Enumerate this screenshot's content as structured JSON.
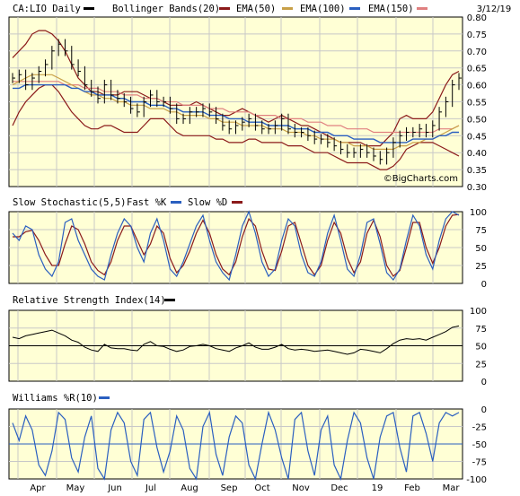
{
  "chart_data": [
    {
      "panel": "price",
      "type": "ohlc",
      "title": "CA:LIO Daily",
      "date": "3/12/19",
      "legend": [
        {
          "name": "CA:LIO Daily",
          "color": "#000000"
        },
        {
          "name": "Bollinger Bands(20)",
          "color": "#8b1a1a"
        },
        {
          "name": "EMA(50)",
          "color": "#c8a048"
        },
        {
          "name": "EMA(100)",
          "color": "#2a5fc0"
        },
        {
          "name": "EMA(150)",
          "color": "#e08080"
        }
      ],
      "watermark": "©BigCharts.com",
      "ylim": [
        0.3,
        0.8
      ],
      "y_ticks": [
        "0.30",
        "0.35",
        "0.40",
        "0.45",
        "0.50",
        "0.55",
        "0.60",
        "0.65",
        "0.70",
        "0.75",
        "0.80"
      ],
      "x_labels": [
        "Apr",
        "May",
        "Jun",
        "Jul",
        "Aug",
        "Sep",
        "Oct",
        "Nov",
        "Dec",
        "19",
        "Feb",
        "Mar"
      ],
      "close": [
        0.62,
        0.63,
        0.6,
        0.62,
        0.64,
        0.66,
        0.7,
        0.72,
        0.7,
        0.66,
        0.64,
        0.6,
        0.58,
        0.56,
        0.6,
        0.57,
        0.56,
        0.55,
        0.53,
        0.52,
        0.55,
        0.57,
        0.55,
        0.55,
        0.53,
        0.5,
        0.5,
        0.52,
        0.52,
        0.53,
        0.52,
        0.5,
        0.48,
        0.47,
        0.48,
        0.49,
        0.5,
        0.48,
        0.47,
        0.47,
        0.48,
        0.5,
        0.47,
        0.46,
        0.46,
        0.45,
        0.44,
        0.44,
        0.43,
        0.42,
        0.41,
        0.4,
        0.4,
        0.41,
        0.4,
        0.39,
        0.38,
        0.4,
        0.43,
        0.45,
        0.46,
        0.46,
        0.47,
        0.46,
        0.48,
        0.52,
        0.55,
        0.6,
        0.62
      ],
      "bb_upper": [
        0.68,
        0.7,
        0.72,
        0.75,
        0.76,
        0.76,
        0.75,
        0.73,
        0.7,
        0.66,
        0.62,
        0.6,
        0.58,
        0.58,
        0.57,
        0.57,
        0.57,
        0.58,
        0.58,
        0.58,
        0.57,
        0.56,
        0.56,
        0.55,
        0.54,
        0.54,
        0.54,
        0.54,
        0.55,
        0.54,
        0.53,
        0.52,
        0.51,
        0.51,
        0.52,
        0.53,
        0.52,
        0.51,
        0.5,
        0.49,
        0.5,
        0.51,
        0.5,
        0.49,
        0.48,
        0.48,
        0.47,
        0.46,
        0.45,
        0.44,
        0.43,
        0.43,
        0.43,
        0.43,
        0.42,
        0.42,
        0.42,
        0.44,
        0.46,
        0.5,
        0.51,
        0.5,
        0.5,
        0.5,
        0.52,
        0.56,
        0.6,
        0.63,
        0.64
      ],
      "bb_lower": [
        0.48,
        0.52,
        0.55,
        0.57,
        0.59,
        0.6,
        0.6,
        0.58,
        0.55,
        0.52,
        0.5,
        0.48,
        0.47,
        0.47,
        0.48,
        0.48,
        0.47,
        0.46,
        0.46,
        0.46,
        0.48,
        0.5,
        0.5,
        0.5,
        0.48,
        0.46,
        0.45,
        0.45,
        0.45,
        0.45,
        0.45,
        0.44,
        0.44,
        0.43,
        0.43,
        0.43,
        0.44,
        0.44,
        0.43,
        0.43,
        0.43,
        0.43,
        0.42,
        0.42,
        0.42,
        0.41,
        0.4,
        0.4,
        0.4,
        0.39,
        0.38,
        0.37,
        0.37,
        0.37,
        0.37,
        0.36,
        0.35,
        0.35,
        0.36,
        0.38,
        0.41,
        0.42,
        0.43,
        0.43,
        0.43,
        0.42,
        0.41,
        0.4,
        0.39
      ],
      "ema50": [
        0.6,
        0.61,
        0.62,
        0.63,
        0.63,
        0.63,
        0.63,
        0.62,
        0.61,
        0.6,
        0.59,
        0.58,
        0.57,
        0.57,
        0.56,
        0.56,
        0.55,
        0.55,
        0.54,
        0.54,
        0.54,
        0.53,
        0.53,
        0.53,
        0.52,
        0.52,
        0.51,
        0.51,
        0.51,
        0.51,
        0.5,
        0.5,
        0.49,
        0.49,
        0.49,
        0.48,
        0.48,
        0.48,
        0.48,
        0.47,
        0.47,
        0.47,
        0.46,
        0.46,
        0.46,
        0.45,
        0.45,
        0.44,
        0.44,
        0.44,
        0.43,
        0.43,
        0.42,
        0.42,
        0.42,
        0.41,
        0.41,
        0.41,
        0.41,
        0.42,
        0.42,
        0.43,
        0.43,
        0.44,
        0.44,
        0.45,
        0.46,
        0.47,
        0.48
      ],
      "ema100": [
        0.59,
        0.59,
        0.6,
        0.6,
        0.6,
        0.6,
        0.6,
        0.6,
        0.6,
        0.59,
        0.59,
        0.58,
        0.58,
        0.57,
        0.57,
        0.57,
        0.56,
        0.56,
        0.55,
        0.55,
        0.55,
        0.54,
        0.54,
        0.54,
        0.53,
        0.53,
        0.52,
        0.52,
        0.52,
        0.52,
        0.51,
        0.51,
        0.51,
        0.5,
        0.5,
        0.5,
        0.49,
        0.49,
        0.49,
        0.48,
        0.48,
        0.48,
        0.48,
        0.47,
        0.47,
        0.47,
        0.46,
        0.46,
        0.46,
        0.45,
        0.45,
        0.45,
        0.44,
        0.44,
        0.44,
        0.44,
        0.43,
        0.43,
        0.43,
        0.43,
        0.43,
        0.44,
        0.44,
        0.44,
        0.44,
        0.45,
        0.45,
        0.46,
        0.46
      ],
      "ema150": [
        0.61,
        0.61,
        0.61,
        0.61,
        0.61,
        0.61,
        0.61,
        0.61,
        0.6,
        0.6,
        0.6,
        0.59,
        0.59,
        0.59,
        0.58,
        0.58,
        0.58,
        0.57,
        0.57,
        0.57,
        0.56,
        0.56,
        0.56,
        0.55,
        0.55,
        0.55,
        0.54,
        0.54,
        0.54,
        0.54,
        0.53,
        0.53,
        0.53,
        0.52,
        0.52,
        0.52,
        0.52,
        0.51,
        0.51,
        0.51,
        0.51,
        0.5,
        0.5,
        0.5,
        0.5,
        0.49,
        0.49,
        0.49,
        0.48,
        0.48,
        0.48,
        0.47,
        0.47,
        0.47,
        0.47,
        0.46,
        0.46,
        0.46,
        0.46,
        0.46,
        0.46,
        0.46,
        0.46,
        0.46,
        0.46,
        0.47,
        0.47,
        0.47,
        0.48
      ]
    },
    {
      "panel": "stochastic",
      "type": "line",
      "title": "Slow Stochastic(5,5)",
      "legend": [
        {
          "name": "Fast %K",
          "color": "#2a5fc0"
        },
        {
          "name": "Slow %D",
          "color": "#8b1a1a"
        }
      ],
      "ylim": [
        0,
        100
      ],
      "y_ticks": [
        "0",
        "25",
        "50",
        "75",
        "100"
      ],
      "fast_k": [
        70,
        60,
        80,
        75,
        40,
        20,
        10,
        30,
        85,
        90,
        60,
        40,
        20,
        10,
        5,
        40,
        70,
        90,
        80,
        50,
        30,
        70,
        90,
        60,
        20,
        10,
        30,
        55,
        80,
        95,
        60,
        30,
        15,
        5,
        40,
        80,
        100,
        70,
        30,
        10,
        20,
        60,
        90,
        80,
        40,
        15,
        10,
        30,
        70,
        95,
        60,
        20,
        10,
        40,
        85,
        90,
        55,
        15,
        5,
        20,
        60,
        95,
        80,
        40,
        20,
        60,
        90,
        100,
        95
      ],
      "slow_d": [
        65,
        65,
        72,
        74,
        60,
        40,
        25,
        25,
        55,
        80,
        75,
        55,
        30,
        18,
        12,
        30,
        60,
        80,
        80,
        60,
        40,
        55,
        80,
        70,
        35,
        15,
        25,
        45,
        70,
        88,
        70,
        40,
        20,
        12,
        30,
        65,
        90,
        80,
        45,
        20,
        18,
        45,
        80,
        85,
        55,
        25,
        12,
        25,
        60,
        85,
        70,
        35,
        15,
        30,
        70,
        88,
        65,
        25,
        10,
        18,
        50,
        85,
        85,
        50,
        28,
        50,
        80,
        95,
        96
      ]
    },
    {
      "panel": "rsi",
      "type": "line",
      "title": "Relative Strength Index(14)",
      "ylim": [
        0,
        100
      ],
      "y_ticks": [
        "0",
        "25",
        "50",
        "75",
        "100"
      ],
      "reference_line": 50,
      "values": [
        62,
        60,
        64,
        66,
        68,
        70,
        72,
        68,
        64,
        58,
        55,
        48,
        44,
        42,
        52,
        47,
        46,
        46,
        44,
        43,
        52,
        56,
        50,
        49,
        45,
        42,
        44,
        49,
        50,
        52,
        50,
        46,
        44,
        42,
        47,
        50,
        54,
        48,
        45,
        45,
        48,
        52,
        46,
        44,
        45,
        44,
        42,
        43,
        44,
        42,
        40,
        38,
        40,
        45,
        44,
        42,
        40,
        46,
        53,
        58,
        60,
        59,
        60,
        58,
        62,
        66,
        70,
        76,
        78
      ]
    },
    {
      "panel": "williams",
      "type": "line",
      "title": "Williams %R(10)",
      "legend": [
        {
          "name": "Williams %R(10)",
          "color": "#2a5fc0"
        }
      ],
      "ylim": [
        -100,
        0
      ],
      "y_ticks": [
        "-100",
        "-75",
        "-50",
        "-25",
        "0"
      ],
      "reference_line": -50,
      "values": [
        -20,
        -45,
        -10,
        -30,
        -80,
        -95,
        -60,
        -5,
        -15,
        -70,
        -90,
        -40,
        -10,
        -85,
        -100,
        -30,
        -5,
        -20,
        -75,
        -95,
        -15,
        -5,
        -55,
        -90,
        -60,
        -10,
        -30,
        -85,
        -100,
        -25,
        -5,
        -65,
        -95,
        -40,
        -10,
        -20,
        -80,
        -100,
        -50,
        -5,
        -30,
        -70,
        -100,
        -15,
        -5,
        -60,
        -95,
        -30,
        -10,
        -80,
        -100,
        -45,
        -5,
        -20,
        -70,
        -100,
        -40,
        -10,
        -5,
        -55,
        -90,
        -10,
        -5,
        -35,
        -75,
        -20,
        -5,
        -10,
        -5
      ]
    }
  ]
}
